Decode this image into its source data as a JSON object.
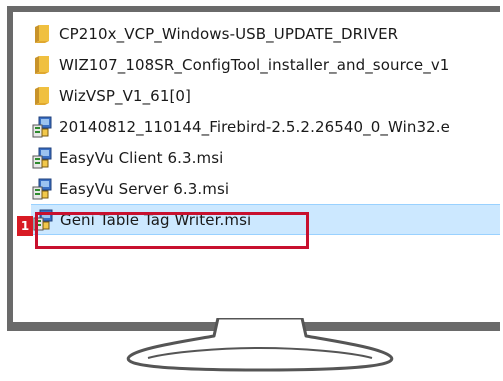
{
  "explorer": {
    "files": [
      {
        "name": "CP210x_VCP_Windows-USB_UPDATE_DRIVER",
        "icon": "folder-icon",
        "selected": false
      },
      {
        "name": "WIZ107_108SR_ConfigTool_installer_and_source_v1",
        "icon": "folder-icon",
        "selected": false
      },
      {
        "name": "WizVSP_V1_61[0]",
        "icon": "folder-icon",
        "selected": false
      },
      {
        "name": "20140812_110144_Firebird-2.5.2.26540_0_Win32.e",
        "icon": "installer-package-icon",
        "selected": false
      },
      {
        "name": "EasyVu Client 6.3.msi",
        "icon": "installer-package-icon",
        "selected": false
      },
      {
        "name": "EasyVu Server 6.3.msi",
        "icon": "installer-package-icon",
        "selected": false
      },
      {
        "name": "Geni Table Tag Writer.msi",
        "icon": "installer-package-icon",
        "selected": true
      }
    ]
  },
  "annotation": {
    "step_number": "1",
    "color": "#c8102e"
  },
  "colors": {
    "folder": "#e8b53a",
    "selection": "#cce8ff",
    "bezel": "#6a6a6a"
  }
}
